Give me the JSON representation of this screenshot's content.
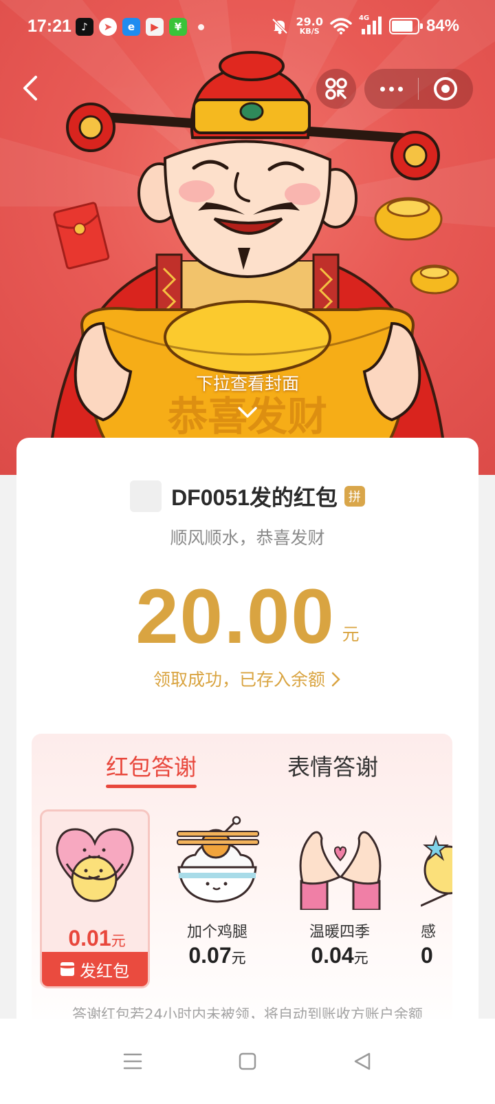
{
  "status_bar": {
    "time": "17:21",
    "net_speed_value": "29.0",
    "net_speed_unit": "KB/S",
    "network": "4G",
    "battery_percent": 84,
    "battery_text": "84%"
  },
  "banner": {
    "pull_hint": "下拉查看封面",
    "ingot_text": "恭喜发财"
  },
  "envelope": {
    "sender_title": "DF0051发的红包",
    "group_badge": "拼",
    "blessing": "顺风顺水，恭喜发财",
    "amount": "20.00",
    "unit": "元",
    "received_text": "领取成功，已存入余额"
  },
  "thanks": {
    "tabs": [
      {
        "label": "红包答谢",
        "active": true
      },
      {
        "label": "表情答谢",
        "active": false
      }
    ],
    "gifts": [
      {
        "label": "",
        "price": "0.01",
        "unit": "元",
        "selected": true,
        "icon": "heart-hug-icon"
      },
      {
        "label": "加个鸡腿",
        "price": "0.07",
        "unit": "元",
        "selected": false,
        "icon": "rice-bowl-drumstick-icon"
      },
      {
        "label": "温暖四季",
        "price": "0.04",
        "unit": "元",
        "selected": false,
        "icon": "heart-hands-icon"
      },
      {
        "label": "感",
        "price": "0",
        "unit": "",
        "selected": false,
        "icon": "star-chick-icon"
      }
    ],
    "send_button": "发红包",
    "footnote": "答谢红包若24小时内未被领，将自动到账收方账户余额"
  },
  "colors": {
    "banner_red": "#e85a55",
    "gold": "#d9a441",
    "accent_red": "#e8473c"
  }
}
